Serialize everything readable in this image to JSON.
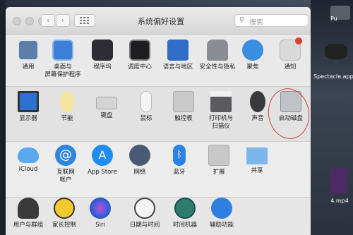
{
  "window": {
    "title": "系统偏好设置",
    "grid_icon": "grid-icon"
  },
  "search": {
    "placeholder": "搜索"
  },
  "rows": [
    [
      {
        "name": "general",
        "label": "通用",
        "icon": "general-icon"
      },
      {
        "name": "desktop-screensaver",
        "label": "桌面与\n屏幕保护程序",
        "icon": "desktop-icon"
      },
      {
        "name": "dock",
        "label": "程序坞",
        "icon": "dock-icon"
      },
      {
        "name": "mission-control",
        "label": "调度中心",
        "icon": "mission-control-icon"
      },
      {
        "name": "language-region",
        "label": "语言与地区",
        "icon": "flag-icon"
      },
      {
        "name": "security-privacy",
        "label": "安全性与隐私",
        "icon": "house-lock-icon"
      },
      {
        "name": "spotlight",
        "label": "聚焦",
        "icon": "magnifier-icon"
      },
      {
        "name": "notifications",
        "label": "通知",
        "icon": "notification-icon"
      }
    ],
    [
      {
        "name": "displays",
        "label": "显示器",
        "icon": "display-icon"
      },
      {
        "name": "energy-saver",
        "label": "节能",
        "icon": "bulb-icon"
      },
      {
        "name": "keyboard",
        "label": "键盘",
        "icon": "keyboard-icon"
      },
      {
        "name": "mouse",
        "label": "鼠标",
        "icon": "mouse-icon"
      },
      {
        "name": "trackpad",
        "label": "触控板",
        "icon": "trackpad-icon"
      },
      {
        "name": "printers-scanners",
        "label": "打印机与\n扫描仪",
        "icon": "printer-icon"
      },
      {
        "name": "sound",
        "label": "声音",
        "icon": "speaker-icon"
      },
      {
        "name": "startup-disk",
        "label": "启动磁盘",
        "icon": "disk-icon"
      }
    ],
    [
      {
        "name": "icloud",
        "label": "iCloud",
        "icon": "cloud-icon"
      },
      {
        "name": "internet-accounts",
        "label": "互联网\n帐户",
        "icon": "at-icon"
      },
      {
        "name": "app-store",
        "label": "App Store",
        "icon": "app-store-icon"
      },
      {
        "name": "network",
        "label": "网络",
        "icon": "globe-icon"
      },
      {
        "name": "bluetooth",
        "label": "蓝牙",
        "icon": "bluetooth-icon"
      },
      {
        "name": "extensions",
        "label": "扩展",
        "icon": "puzzle-icon"
      },
      {
        "name": "sharing",
        "label": "共享",
        "icon": "sharing-folder-icon"
      }
    ],
    [
      {
        "name": "users-groups",
        "label": "用户与群组",
        "icon": "users-icon"
      },
      {
        "name": "parental-controls",
        "label": "家长控制",
        "icon": "parental-icon"
      },
      {
        "name": "siri",
        "label": "Siri",
        "icon": "siri-icon"
      },
      {
        "name": "date-time",
        "label": "日期与时间",
        "icon": "calendar-clock-icon"
      },
      {
        "name": "time-machine",
        "label": "时间机器",
        "icon": "time-machine-icon"
      },
      {
        "name": "accessibility",
        "label": "辅助功能",
        "icon": "accessibility-icon"
      }
    ]
  ],
  "desktop_items": {
    "item1": "Pu",
    "item2": "Spectacle.app",
    "item3": "4.mp4"
  },
  "colors": {
    "highlight_circle": "#d2433a"
  }
}
